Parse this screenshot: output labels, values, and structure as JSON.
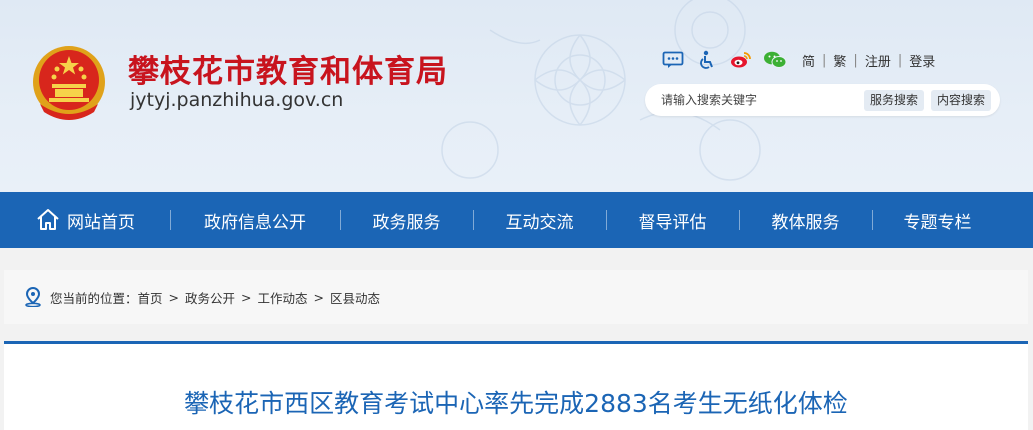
{
  "header": {
    "site_title": "攀枝花市教育和体育局",
    "site_domain": "jytyj.panzhihua.gov.cn",
    "tools": [
      {
        "name": "message-icon"
      },
      {
        "name": "accessibility-icon"
      },
      {
        "name": "weibo-icon"
      },
      {
        "name": "wechat-icon"
      }
    ],
    "links": {
      "simplified": "简",
      "traditional": "繁",
      "register": "注册",
      "login": "登录"
    },
    "search": {
      "placeholder": "请输入搜索关键字",
      "service_search": "服务搜索",
      "content_search": "内容搜索"
    }
  },
  "nav": {
    "items": [
      {
        "label": "网站首页",
        "icon": "home-icon"
      },
      {
        "label": "政府信息公开"
      },
      {
        "label": "政务服务"
      },
      {
        "label": "互动交流"
      },
      {
        "label": "督导评估"
      },
      {
        "label": "教体服务"
      },
      {
        "label": "专题专栏"
      }
    ]
  },
  "breadcrumb": {
    "prefix": "您当前的位置：",
    "items": [
      "首页",
      "政务公开",
      "工作动态",
      "区县动态"
    ]
  },
  "article": {
    "title": "攀枝花市西区教育考试中心率先完成2883名考生无纸化体检"
  },
  "colors": {
    "brand_red": "#c8141e",
    "nav_blue": "#1b65b5",
    "title_blue": "#1b65b5"
  }
}
